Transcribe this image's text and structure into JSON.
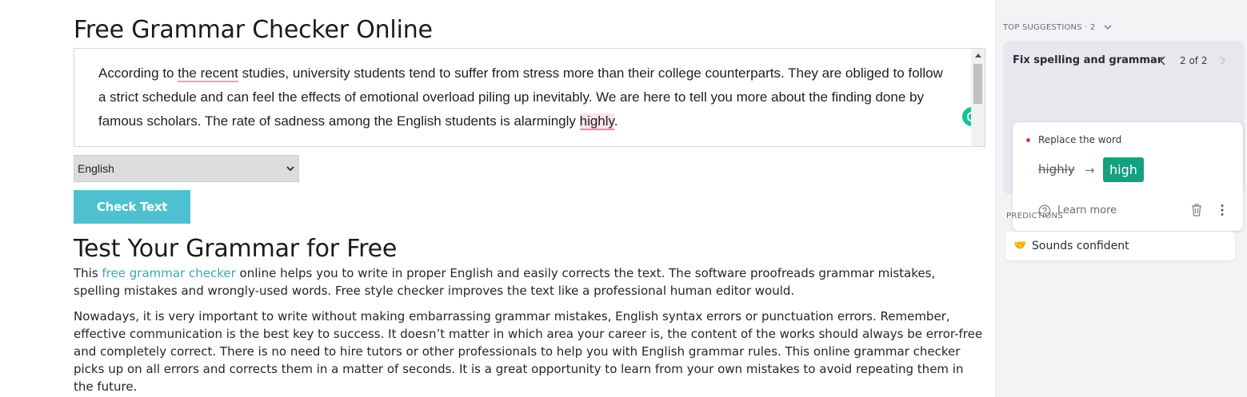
{
  "page": {
    "title": "Free Grammar Checker Online",
    "editor": {
      "text_before": "According to ",
      "flag1": "the recent",
      "text_middle": " studies, university students tend to suffer from stress more than their college counterparts. They are obliged to follow a strict schedule and can feel the effects of emotional overload piling up inevitably. We are here to tell you more about the finding done by famous scholars. The rate of sadness among the English students is alarmingly ",
      "flag2": "highly",
      "text_after": "."
    },
    "language_select": {
      "selected": "English"
    },
    "check_button": "Check Text",
    "section_title": "Test Your Grammar for Free",
    "para1": {
      "before": "This ",
      "link": "free grammar checker",
      "after": " online helps you to write in proper English and easily corrects the text. The software proofreads grammar mistakes, spelling mistakes and wrongly-used words. Free style checker improves the text like a professional human editor would."
    },
    "para2": "Nowadays, it is very important to write without making embarrassing grammar mistakes, English syntax errors or punctuation errors. Remember, effective communication is the best key to success. It doesn’t matter in which area your career is, the content of the works should always be error-free and completely correct. There is no need to hire tutors or other professionals to help you with English grammar rules. This online grammar checker picks up on all errors and corrects them in a matter of seconds. It is a great opportunity to learn from your own mistakes to avoid repeating them in the future."
  },
  "panel": {
    "top_suggestions_label": "TOP SUGGESTIONS · 2",
    "group_title": "Fix spelling and grammar",
    "group_counter": "2 of 2",
    "card": {
      "label": "Replace the word",
      "old_word": "highly",
      "arrow": "→",
      "new_word": "high",
      "learn_more": "Learn more"
    },
    "predictions_label": "PREDICTIONS",
    "prediction": {
      "emoji": "🤝",
      "text": "Sounds confident"
    }
  },
  "colors": {
    "accent_button": "#4fc0d0",
    "link": "#3aa9bc",
    "grammarly_green": "#15c39a",
    "replacement_green": "#13a181",
    "error_red": "#e0354d"
  },
  "icons": [
    "grammarly-icon",
    "chevron-down-icon",
    "chevron-left-icon",
    "chevron-right-icon",
    "help-circle-icon",
    "trash-icon",
    "more-vertical-icon"
  ]
}
